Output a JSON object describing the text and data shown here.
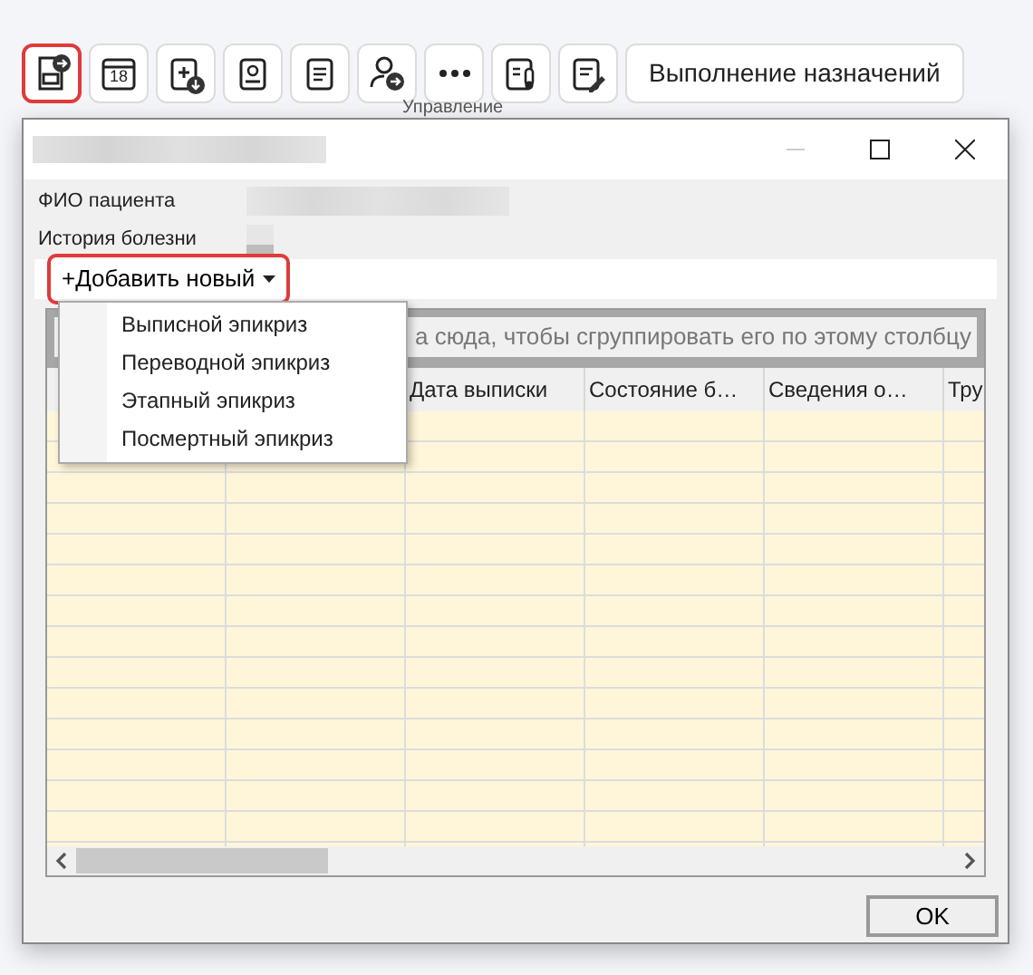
{
  "toolbar": {
    "buttons": [
      {
        "kind": "icon",
        "highlighted": true
      },
      {
        "kind": "icon",
        "label": "18",
        "highlighted": false
      },
      {
        "kind": "icon",
        "highlighted": false
      },
      {
        "kind": "icon",
        "highlighted": false
      },
      {
        "kind": "icon",
        "highlighted": false
      },
      {
        "kind": "icon",
        "highlighted": false
      },
      {
        "kind": "icon",
        "highlighted": false
      },
      {
        "kind": "icon",
        "highlighted": false
      },
      {
        "kind": "icon",
        "highlighted": false
      },
      {
        "kind": "text",
        "label": "Выполнение назначений",
        "highlighted": false
      }
    ],
    "group_label": "Управление"
  },
  "dialog": {
    "fields": [
      {
        "label": "ФИО пациента"
      },
      {
        "label": "История болезни"
      }
    ],
    "add_button": {
      "label": "+Добавить новый",
      "highlighted": true,
      "expanded": true
    },
    "menu": [
      {
        "label": "Выписной эпикриз"
      },
      {
        "label": "Переводной эпикриз"
      },
      {
        "label": "Этапный эпикриз"
      },
      {
        "label": "Посмертный эпикриз"
      }
    ],
    "grid": {
      "group_panel_hint": "а сюда, чтобы сгруппировать его по этому столбцу",
      "columns": [
        "",
        "",
        "Дата выписки",
        "Состояние б…",
        "Сведения о…",
        "Тру"
      ]
    },
    "ok_button": "OK"
  }
}
